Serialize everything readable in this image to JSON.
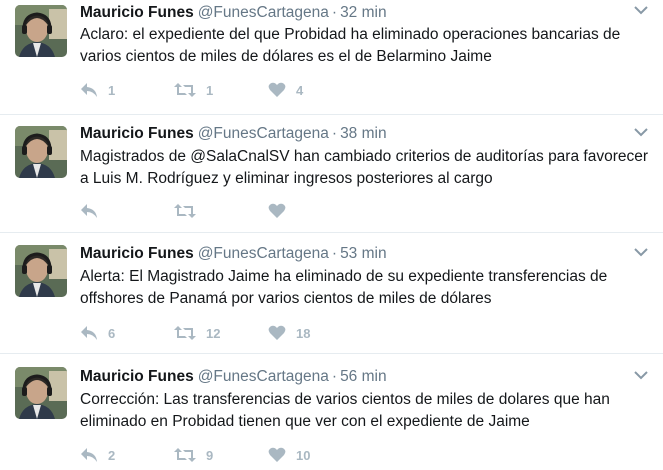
{
  "tweets": [
    {
      "name": "Mauricio Funes",
      "handle": "@FunesCartagena",
      "separator": "·",
      "time": "32 min",
      "text": "Aclaro: el expediente del que Probidad ha eliminado operaciones bancarias de varios cientos de miles de dólares es el de Belarmino Jaime",
      "replies": "1",
      "retweets": "1",
      "likes": "4"
    },
    {
      "name": "Mauricio Funes",
      "handle": "@FunesCartagena",
      "separator": "·",
      "time": "38 min",
      "text": "Magistrados de @SalaCnalSV han cambiado criterios de auditorías para favorecer a Luis M. Rodríguez y eliminar ingresos posteriores al cargo",
      "replies": "",
      "retweets": "",
      "likes": ""
    },
    {
      "name": "Mauricio Funes",
      "handle": "@FunesCartagena",
      "separator": "·",
      "time": "53 min",
      "text": "Alerta: El Magistrado Jaime ha eliminado de su expediente  transferencias de offshores de Panamá por varios cientos de miles de dólares",
      "replies": "6",
      "retweets": "12",
      "likes": "18"
    },
    {
      "name": "Mauricio Funes",
      "handle": "@FunesCartagena",
      "separator": "·",
      "time": "56 min",
      "text": "Corrección: Las transferencias de varios cientos de miles de dolares que han eliminado en Probidad tienen que ver con el expediente de Jaime",
      "replies": "2",
      "retweets": "9",
      "likes": "10"
    }
  ],
  "icons": {
    "reply": "reply-icon",
    "retweet": "retweet-icon",
    "like": "heart-icon",
    "caret": "chevron-down-icon"
  },
  "colors": {
    "text": "#14171a",
    "secondary": "#657786",
    "action_gray": "#aab8c2",
    "divider": "#e6ecf0"
  }
}
